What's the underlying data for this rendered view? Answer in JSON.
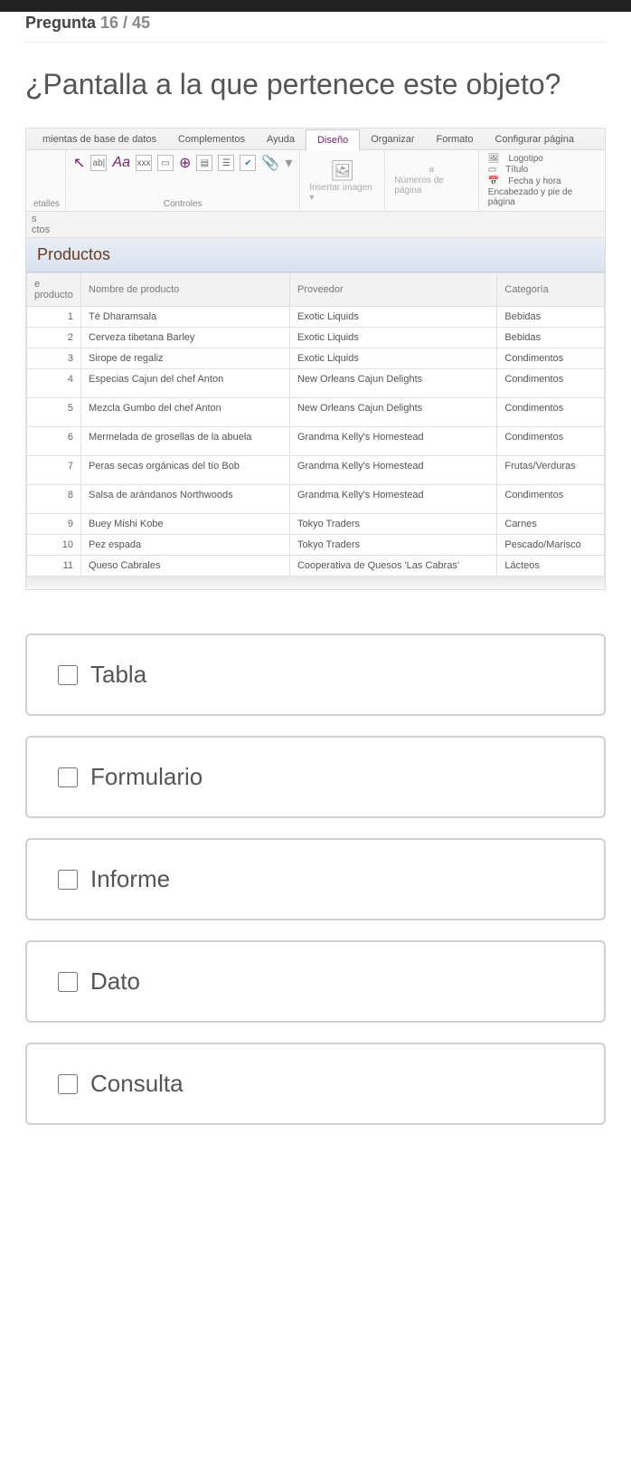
{
  "progress": {
    "label": "Pregunta",
    "counter": "16 / 45"
  },
  "question": "¿Pantalla a la que pertenece este objeto?",
  "figure": {
    "ribbonTabs": [
      "mientas de base de datos",
      "Complementos",
      "Ayuda",
      "Diseño",
      "Organizar",
      "Formato",
      "Configurar página"
    ],
    "activeTabIndex": 3,
    "leftGroupLabel": "etalles",
    "controlsLabel": "Controles",
    "insertLabel": "Insertar imagen ▾",
    "numbersLabel": "Números de página",
    "headerItems": [
      "Logotipo",
      "Título",
      "Fecha y hora"
    ],
    "headerGroupLabel": "Encabezado y pie de página",
    "leftTabs": [
      "s",
      "ctos"
    ],
    "reportTitle": "Productos",
    "columns": [
      "e producto",
      "Nombre de producto",
      "Proveedor",
      "Categoría"
    ],
    "rows": [
      {
        "id": "1",
        "name": "Té Dharamsala",
        "supplier": "Exotic Liquids",
        "cat": "Bebidas",
        "spaced": false
      },
      {
        "id": "2",
        "name": "Cerveza tibetana Barley",
        "supplier": "Exotic Liquids",
        "cat": "Bebidas",
        "spaced": false
      },
      {
        "id": "3",
        "name": "Sirope de regaliz",
        "supplier": "Exotic Liquids",
        "cat": "Condimentos",
        "spaced": false
      },
      {
        "id": "4",
        "name": "Especias Cajun del chef Anton",
        "supplier": "New Orleans Cajun Delights",
        "cat": "Condimentos",
        "spaced": true
      },
      {
        "id": "5",
        "name": "Mezcla Gumbo del chef Anton",
        "supplier": "New Orleans Cajun Delights",
        "cat": "Condimentos",
        "spaced": true
      },
      {
        "id": "6",
        "name": "Mermelada de grosellas de la abuela",
        "supplier": "Grandma Kelly's Homestead",
        "cat": "Condimentos",
        "spaced": true
      },
      {
        "id": "7",
        "name": "Peras secas orgánicas del tío Bob",
        "supplier": "Grandma Kelly's Homestead",
        "cat": "Frutas/Verduras",
        "spaced": true
      },
      {
        "id": "8",
        "name": "Salsa de arándanos Northwoods",
        "supplier": "Grandma Kelly's Homestead",
        "cat": "Condimentos",
        "spaced": true
      },
      {
        "id": "9",
        "name": "Buey Mishi Kobe",
        "supplier": "Tokyo Traders",
        "cat": "Carnes",
        "spaced": false
      },
      {
        "id": "10",
        "name": "Pez espada",
        "supplier": "Tokyo Traders",
        "cat": "Pescado/Marisco",
        "spaced": false
      },
      {
        "id": "11",
        "name": "Queso Cabrales",
        "supplier": "Cooperativa de Quesos 'Las Cabras'",
        "cat": "Lácteos",
        "spaced": false
      }
    ]
  },
  "options": [
    "Tabla",
    "Formulario",
    "Informe",
    "Dato",
    "Consulta"
  ]
}
